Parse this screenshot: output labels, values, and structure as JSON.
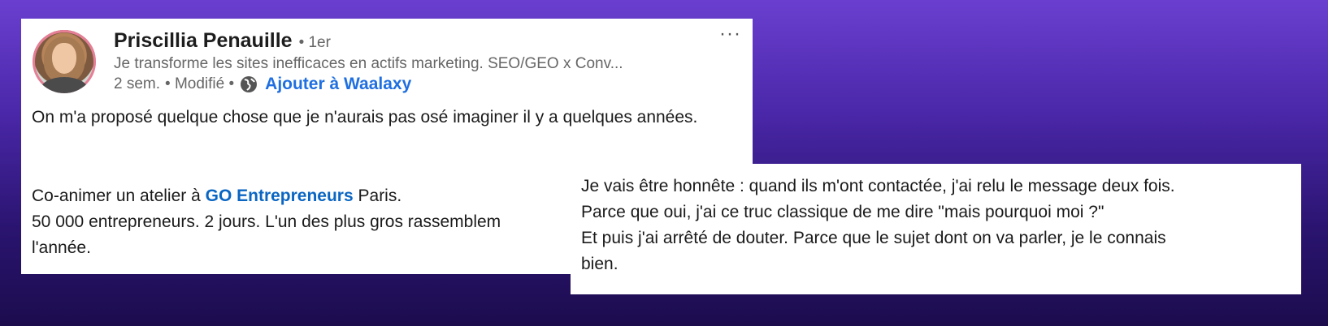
{
  "post": {
    "author": {
      "name": "Priscillia Penauille",
      "degree": "• 1er",
      "headline": "Je transforme les sites inefficaces en actifs marketing. SEO/GEO x Conv...",
      "time": "2 sem.",
      "edited": "• Modifié •",
      "action": "Ajouter à Waalaxy"
    },
    "more_label": "···",
    "body": {
      "p1": "On m'a proposé quelque chose que je n'aurais pas osé imaginer il y a quelques années.",
      "p2_before": "Co-animer un atelier à ",
      "p2_link": "GO Entrepreneurs",
      "p2_after": " Paris.",
      "p3": "50 000 entrepreneurs. 2 jours. L'un des plus gros rassemblem",
      "p4": "l'année."
    }
  },
  "overlay": {
    "lines": [
      "Je vais être honnête : quand ils m'ont contactée, j'ai relu le message deux fois.",
      "Parce que oui, j'ai ce truc classique de me dire \"mais pourquoi moi ?\"",
      "Et puis j'ai arrêté de douter. Parce que le sujet dont on va parler, je le connais",
      "bien."
    ]
  },
  "icons": {
    "globe": "globe-icon",
    "more": "more-horizontal-icon"
  }
}
